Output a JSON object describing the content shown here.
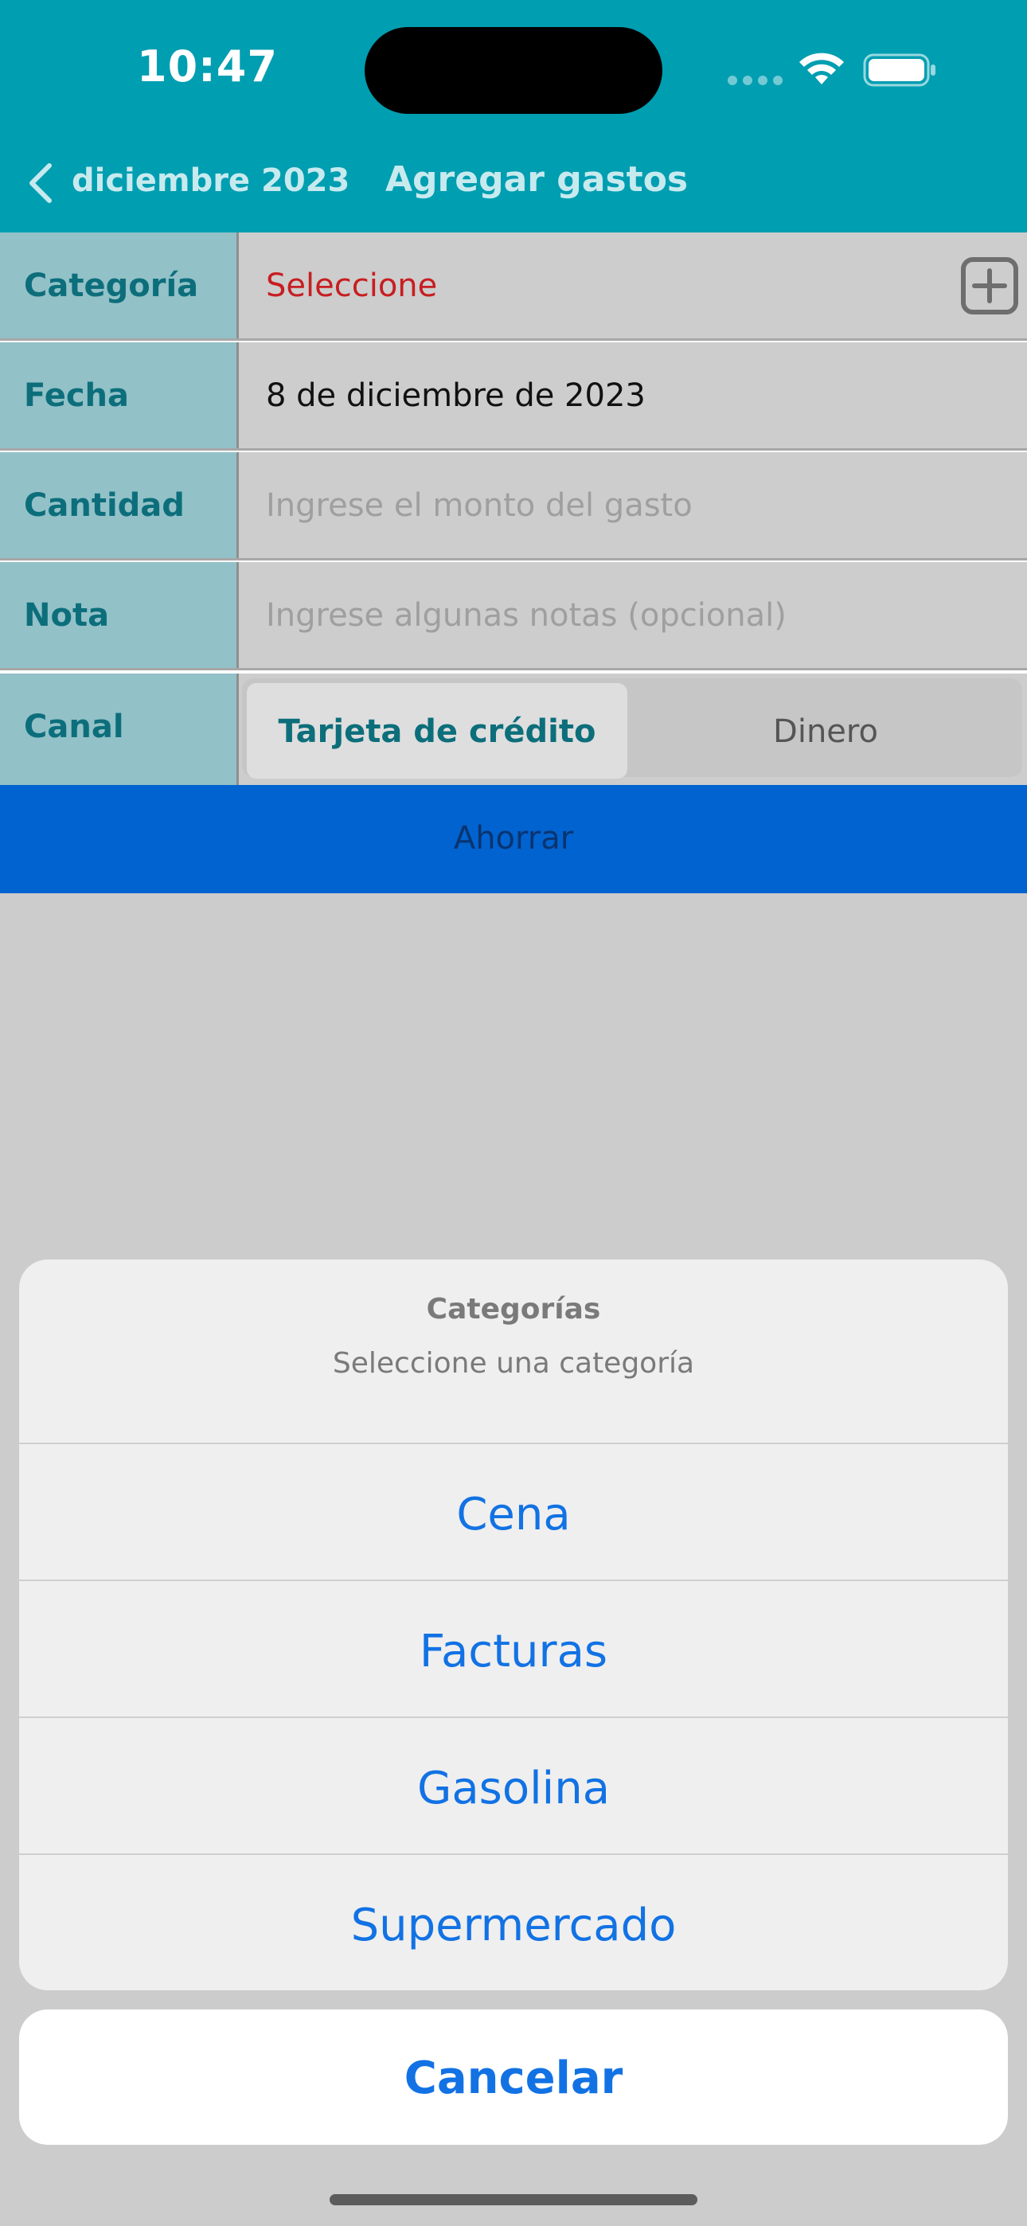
{
  "status_bar": {
    "time": "10:47",
    "icons": [
      "signal-dots-icon",
      "wifi-icon",
      "battery-icon"
    ]
  },
  "nav": {
    "back_label": "diciembre 2023",
    "title": "Agregar gastos",
    "back_icon": "chevron-left-icon"
  },
  "form": {
    "category": {
      "label": "Categoría",
      "value": "Seleccione",
      "add_icon": "plus-square-icon"
    },
    "date": {
      "label": "Fecha",
      "value": "8 de diciembre de 2023"
    },
    "amount": {
      "label": "Cantidad",
      "placeholder": "Ingrese el monto del gasto"
    },
    "note": {
      "label": "Nota",
      "placeholder": "Ingrese algunas notas (opcional)"
    },
    "channel": {
      "label": "Canal",
      "options": [
        "Tarjeta de crédito",
        "Dinero"
      ],
      "selected": "Tarjeta de crédito"
    },
    "save_label": "Ahorrar"
  },
  "action_sheet": {
    "title": "Categorías",
    "subtitle": "Seleccione una categoría",
    "options": [
      {
        "label": "Cena"
      },
      {
        "label": "Facturas"
      },
      {
        "label": "Gasolina"
      },
      {
        "label": "Supermercado"
      }
    ],
    "cancel_label": "Cancelar"
  },
  "colors": {
    "header": "#009eb1",
    "label_cell": "#92c1c8",
    "label_text": "#0d6e7b",
    "select_red": "#c71e21",
    "save_bar": "#0163cf",
    "action_blue": "#1272e4"
  }
}
